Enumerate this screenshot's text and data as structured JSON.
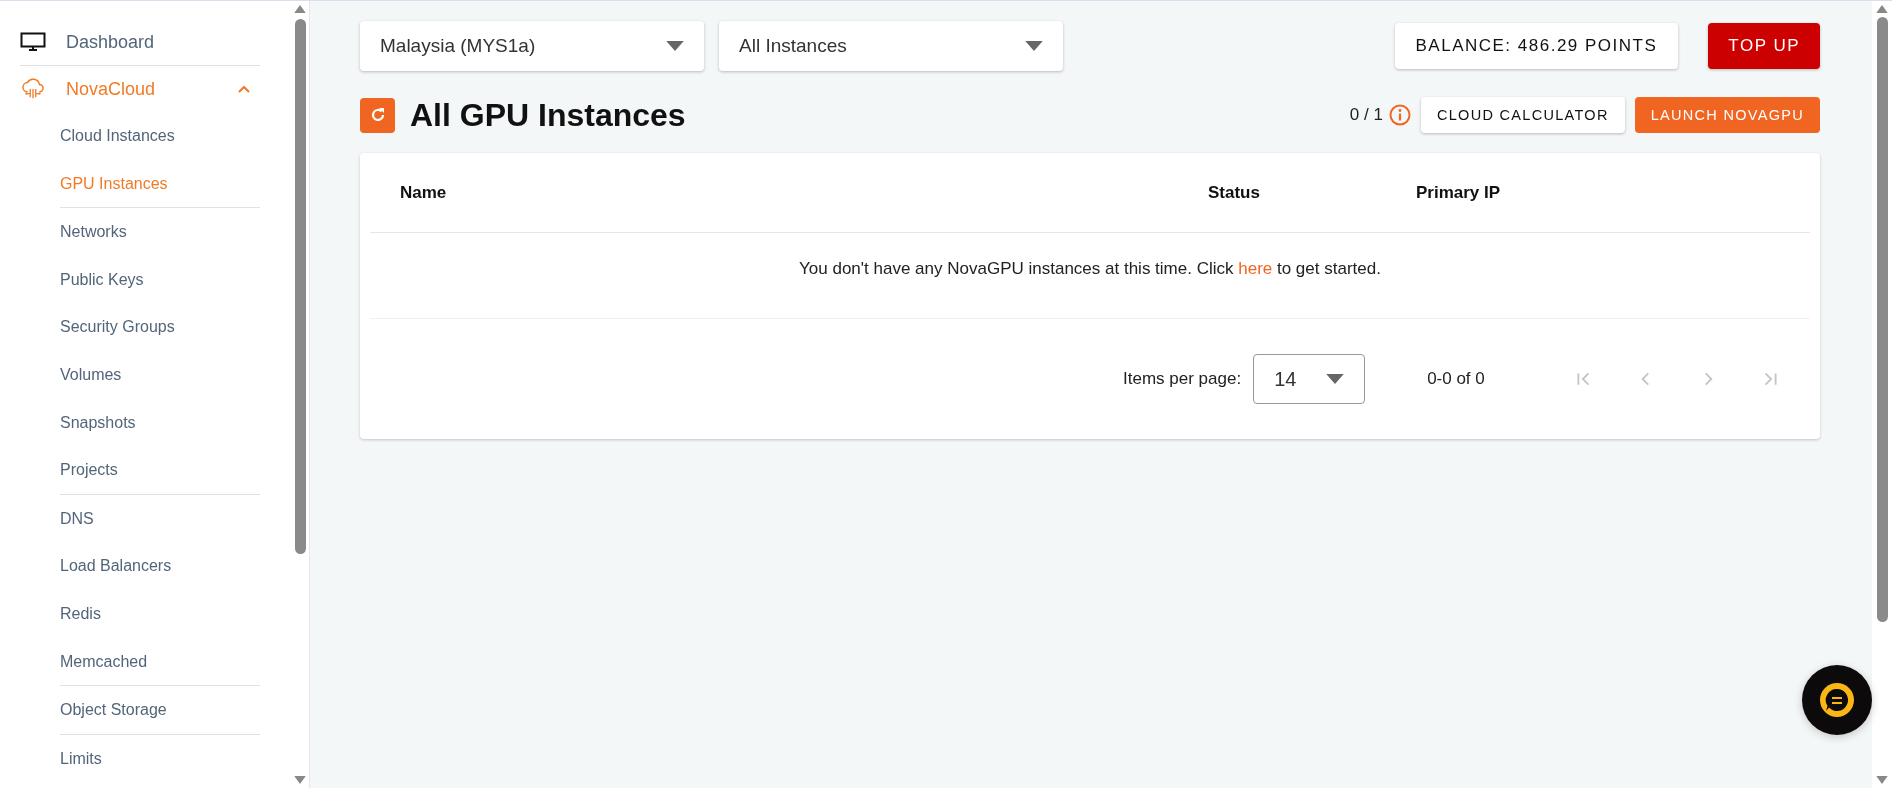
{
  "sidebar": {
    "items": [
      {
        "kind": "link",
        "label": "Dashboard",
        "selected": false
      },
      {
        "kind": "section",
        "label": "NovaCloud",
        "selected": true,
        "expanded": true,
        "groups": [
          [
            {
              "label": "Cloud Instances",
              "selected": false
            },
            {
              "label": "GPU Instances",
              "selected": true
            }
          ],
          [
            {
              "label": "Networks",
              "selected": false
            },
            {
              "label": "Public Keys",
              "selected": false
            },
            {
              "label": "Security Groups",
              "selected": false
            },
            {
              "label": "Volumes",
              "selected": false
            },
            {
              "label": "Snapshots",
              "selected": false
            },
            {
              "label": "Projects",
              "selected": false
            }
          ],
          [
            {
              "label": "DNS",
              "selected": false
            },
            {
              "label": "Load Balancers",
              "selected": false
            },
            {
              "label": "Redis",
              "selected": false
            },
            {
              "label": "Memcached",
              "selected": false
            }
          ],
          [
            {
              "label": "Object Storage",
              "selected": false
            }
          ],
          [
            {
              "label": "Limits",
              "selected": false
            }
          ]
        ]
      }
    ]
  },
  "toolbar": {
    "region": "Malaysia (MYS1a)",
    "filter": "All Instances",
    "balance": "BALANCE: 486.29 POINTS",
    "top_up": "TOP UP"
  },
  "header": {
    "title": "All GPU Instances",
    "quota": "0 / 1",
    "calculator": "CLOUD CALCULATOR",
    "launch": "LAUNCH NOVAGPU"
  },
  "table": {
    "columns": [
      "Name",
      "Status",
      "Primary IP"
    ],
    "empty_message": {
      "before": "You don't have any NovaGPU instances at this time. Click ",
      "link": "here",
      "after": " to get started."
    }
  },
  "pagination": {
    "label": "Items per page:",
    "per_page": "14",
    "range": "0-0 of 0",
    "disabled": true
  }
}
